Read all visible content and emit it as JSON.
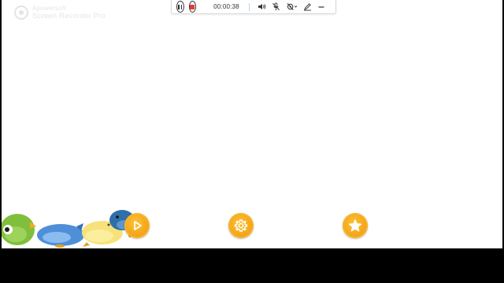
{
  "watermark": {
    "brand": "Apowersoft",
    "product": "Screen Recorder Pro"
  },
  "recorder": {
    "elapsed_time": "00:00:38"
  },
  "colors": {
    "button_orange": "#F4A51A",
    "stop_red": "#E53935",
    "background": "#FFFFFF",
    "letterbox": "#000000"
  },
  "icons": {
    "recorder": [
      "pause-icon",
      "stop-icon",
      "speaker-icon",
      "microphone-muted-icon",
      "camera-muted-icon",
      "pen-icon",
      "minimize-icon"
    ],
    "game_buttons": [
      "play-icon",
      "gear-icon",
      "star-icon"
    ]
  }
}
